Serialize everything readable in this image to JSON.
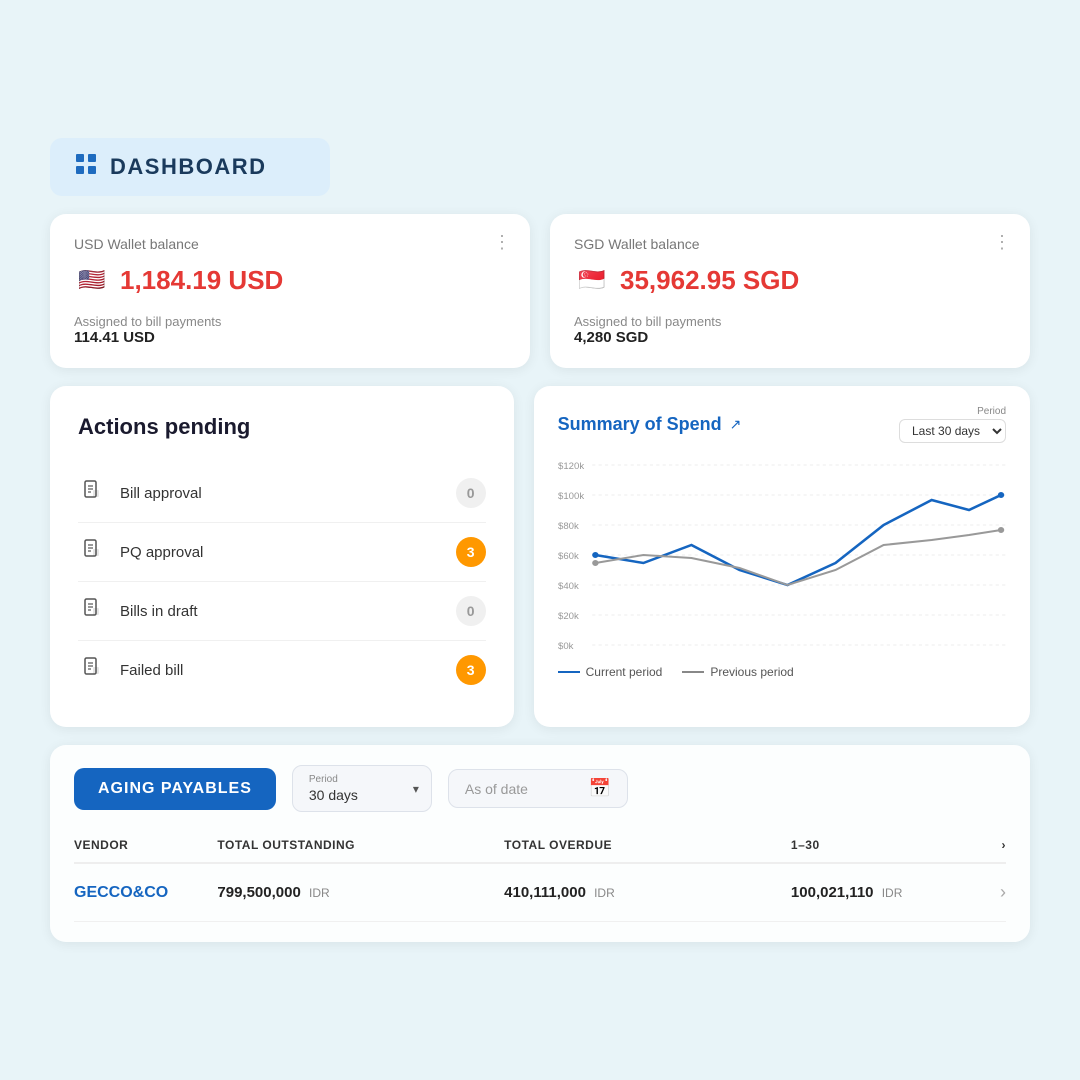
{
  "header": {
    "title": "DASHBOARD",
    "icon": "⊞"
  },
  "wallets": [
    {
      "label": "USD Wallet balance",
      "flag": "🇺🇸",
      "amount": "1,184.19 USD",
      "assigned_label": "Assigned to bill payments",
      "assigned_value": "114.41 USD"
    },
    {
      "label": "SGD Wallet balance",
      "flag": "🇸🇬",
      "amount": "35,962.95 SGD",
      "assigned_label": "Assigned to bill payments",
      "assigned_value": "4,280 SGD"
    }
  ],
  "actions": {
    "title": "Actions pending",
    "items": [
      {
        "label": "Bill approval",
        "count": "0",
        "type": "zero"
      },
      {
        "label": "PQ approval",
        "count": "3",
        "type": "orange"
      },
      {
        "label": "Bills in draft",
        "count": "0",
        "type": "zero"
      },
      {
        "label": "Failed bill",
        "count": "3",
        "type": "orange"
      }
    ]
  },
  "spend": {
    "title": "Summary of Spend",
    "period_label": "Period",
    "period_value": "Last 30 days",
    "y_labels": [
      "$120k",
      "$100k",
      "$80k",
      "$60k",
      "$40k",
      "$20k",
      "$0k"
    ],
    "legend": [
      {
        "label": "Current period",
        "color": "#1565c0"
      },
      {
        "label": "Previous period",
        "color": "#888"
      }
    ]
  },
  "aging": {
    "title": "AGING PAYABLES",
    "period_label": "Period",
    "period_value": "30 days",
    "date_placeholder": "As of date",
    "columns": [
      "VENDOR",
      "TOTAL OUTSTANDING",
      "TOTAL OVERDUE",
      "1-30"
    ],
    "rows": [
      {
        "vendor": "GECCO&CO",
        "outstanding": "799,500,000",
        "overdue": "410,111,000",
        "range": "100,021,110"
      }
    ]
  }
}
